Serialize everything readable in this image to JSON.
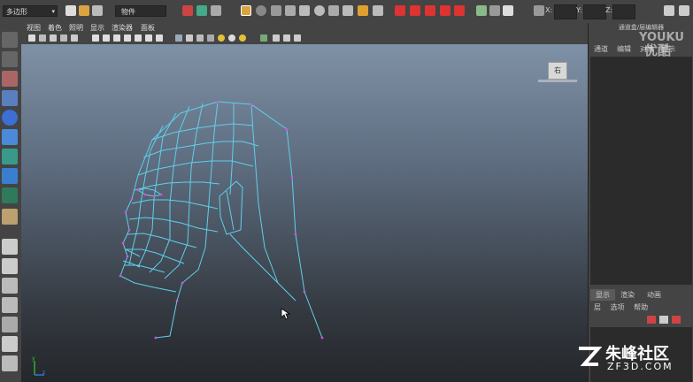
{
  "status_line": {
    "mode_dropdown": "多边形",
    "object_field": "物件",
    "coords": [
      "X:",
      "Y:",
      "Z:"
    ]
  },
  "viewport": {
    "menus": [
      "视图",
      "着色",
      "照明",
      "显示",
      "渲染器",
      "面板"
    ],
    "view_cube_label": "右"
  },
  "right_panel": {
    "title": "通道盒/层编辑器",
    "top_tabs": [
      "通道",
      "编辑",
      "对象",
      "显示"
    ],
    "bottom_tabs": [
      "显示",
      "渲染",
      "动画"
    ],
    "bottom_menu": [
      "层",
      "选项",
      "帮助"
    ]
  },
  "watermarks": {
    "youku_line1": "YOUKU",
    "youku_line2": "优酷",
    "site_line1": "朱峰社区",
    "site_line2": "ZF3D.COM"
  },
  "colors": {
    "wireframe": "#5ed0ea",
    "vertex": "#d84fd8"
  }
}
